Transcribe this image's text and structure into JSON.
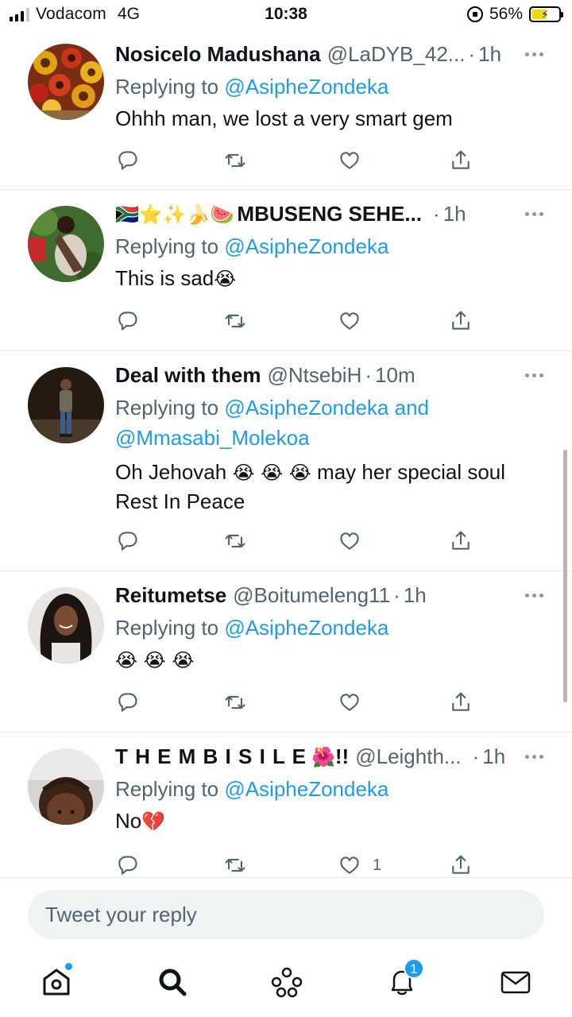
{
  "status_bar": {
    "carrier": "Vodacom",
    "network": "4G",
    "time": "10:38",
    "battery": "56%",
    "battery_level": 0.56,
    "battery_color": "#f5d60f"
  },
  "colors": {
    "accent": "#1d9bf0",
    "muted": "#536471"
  },
  "replies": [
    {
      "name": "Nosicelo Madushana",
      "handle": "@LaDYB_42...",
      "time": "1h",
      "replying_prefix": "Replying to ",
      "mentions": "@AsipheZondeka",
      "mentions_line2": "",
      "text": "Ohhh man, we lost a very smart gem",
      "emoji": "",
      "likes": ""
    },
    {
      "name_emoji": "🇿🇦⭐✨🍌🍉",
      "name": "MBUSENG SEHE...",
      "handle": "",
      "time": "1h",
      "replying_prefix": "Replying to ",
      "mentions": "@AsipheZondeka",
      "mentions_line2": "",
      "text": "This is sad",
      "emoji": "😭",
      "likes": ""
    },
    {
      "name": "Deal with them",
      "handle": "@NtsebiH",
      "time": "10m",
      "replying_prefix": "Replying to ",
      "mentions": "@AsipheZondeka and",
      "mentions_line2": "@Mmasabi_Molekoa",
      "text_prefix": "Oh Jehovah ",
      "emoji": "😭 😭 😭",
      "text": " may her special soul",
      "text_line2": "Rest In Peace",
      "likes": ""
    },
    {
      "name": "Reitumetse",
      "handle": "@Boitumeleng11",
      "time": "1h",
      "replying_prefix": "Replying to ",
      "mentions": "@AsipheZondeka",
      "mentions_line2": "",
      "text": "",
      "emoji": "😭 😭 😭",
      "likes": ""
    },
    {
      "name": "T H E M B I S I L E",
      "name_emoji": "🌺",
      "name_suffix": "!!",
      "handle": "@Leighth...",
      "time": "1h",
      "replying_prefix": "Replying to ",
      "mentions": "@AsipheZondeka",
      "mentions_line2": "",
      "text": "No",
      "emoji": "💔",
      "likes": "1"
    }
  ],
  "reply_box": {
    "placeholder": "Tweet your reply"
  },
  "tab_bar": {
    "items": [
      "home-icon",
      "search-icon",
      "spaces-icon",
      "notifications-icon",
      "messages-icon"
    ],
    "notification_count": "1"
  }
}
